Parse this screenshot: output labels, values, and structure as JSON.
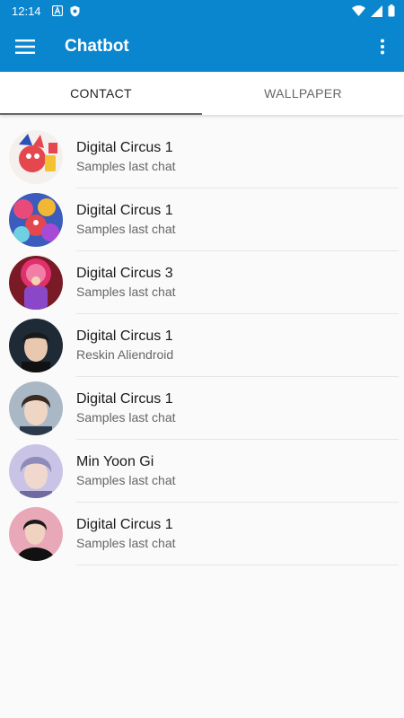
{
  "status_bar": {
    "time": "12:14",
    "left_icons": [
      "font-a-icon",
      "shield-icon"
    ],
    "right_icons": [
      "wifi-icon",
      "signal-icon",
      "battery-icon"
    ]
  },
  "app_bar": {
    "title": "Chatbot",
    "menu_icon": "hamburger-menu-icon",
    "overflow_icon": "more-vert-icon",
    "color": "#0a86cf"
  },
  "tabs": [
    {
      "label": "CONTACT",
      "active": true
    },
    {
      "label": "WALLPAPER",
      "active": false
    }
  ],
  "contacts": [
    {
      "name": "Digital Circus 1",
      "subtitle": "Samples last chat"
    },
    {
      "name": "Digital Circus 1",
      "subtitle": "Samples last chat"
    },
    {
      "name": "Digital Circus 3",
      "subtitle": "Samples last chat"
    },
    {
      "name": "Digital Circus 1",
      "subtitle": "Reskin Aliendroid"
    },
    {
      "name": "Digital Circus 1",
      "subtitle": "Samples last chat"
    },
    {
      "name": "Min Yoon Gi",
      "subtitle": "Samples last chat"
    },
    {
      "name": "Digital Circus 1",
      "subtitle": "Samples last chat"
    }
  ]
}
